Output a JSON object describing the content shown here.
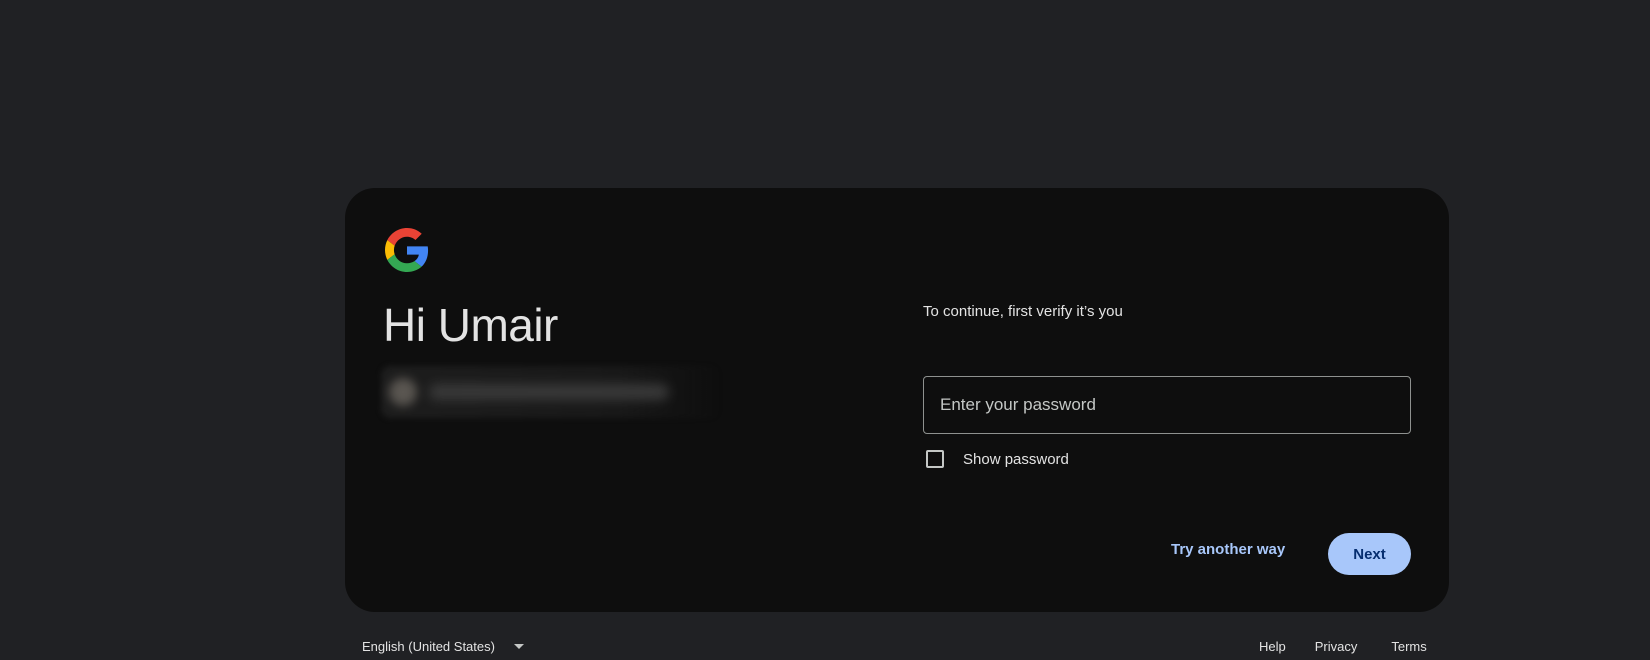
{
  "greeting": "Hi Umair",
  "subtitle": "To continue, first verify it’s you",
  "password": {
    "placeholder": "Enter your password",
    "value": ""
  },
  "show_password_label": "Show password",
  "buttons": {
    "try_another_way": "Try another way",
    "next": "Next"
  },
  "footer": {
    "language": "English (United States)",
    "links": [
      "Help",
      "Privacy",
      "Terms"
    ]
  },
  "colors": {
    "page_bg": "#202124",
    "card_bg": "#0e0e0e",
    "accent": "#a8c7fa",
    "google_blue": "#4285F4",
    "google_red": "#EA4335",
    "google_yellow": "#FBBC05",
    "google_green": "#34A853"
  },
  "icons": {
    "logo": "google-g-logo",
    "language_caret": "caret-down-icon"
  }
}
